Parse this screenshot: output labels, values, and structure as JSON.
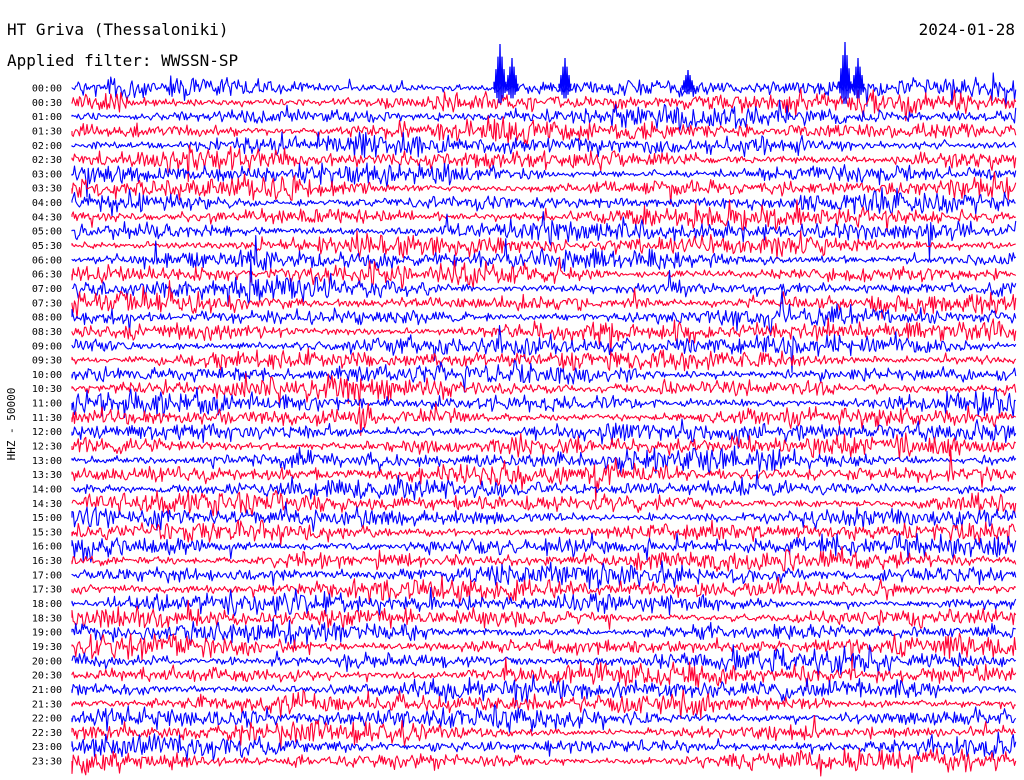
{
  "header": {
    "title": "HT Griva (Thessaloniki)",
    "date": "2024-01-28",
    "filter": "Applied filter: WWSSN-SP"
  },
  "chart_data": {
    "type": "line",
    "ylabel": "HHZ - 50000",
    "rows": [
      "00:00",
      "00:30",
      "01:00",
      "01:30",
      "02:00",
      "02:30",
      "03:00",
      "03:30",
      "04:00",
      "04:30",
      "05:00",
      "05:30",
      "06:00",
      "06:30",
      "07:00",
      "07:30",
      "08:00",
      "08:30",
      "09:00",
      "09:30",
      "10:00",
      "10:30",
      "11:00",
      "11:30",
      "12:00",
      "12:30",
      "13:00",
      "13:30",
      "14:00",
      "14:30",
      "15:00",
      "15:30",
      "16:00",
      "16:30",
      "17:00",
      "17:30",
      "18:00",
      "18:30",
      "19:00",
      "19:30",
      "20:00",
      "20:30",
      "21:00",
      "21:30",
      "22:00",
      "22:30",
      "23:00",
      "23:30"
    ],
    "trace_colors": [
      "#0000ff",
      "#ff0033"
    ],
    "grid": false
  }
}
